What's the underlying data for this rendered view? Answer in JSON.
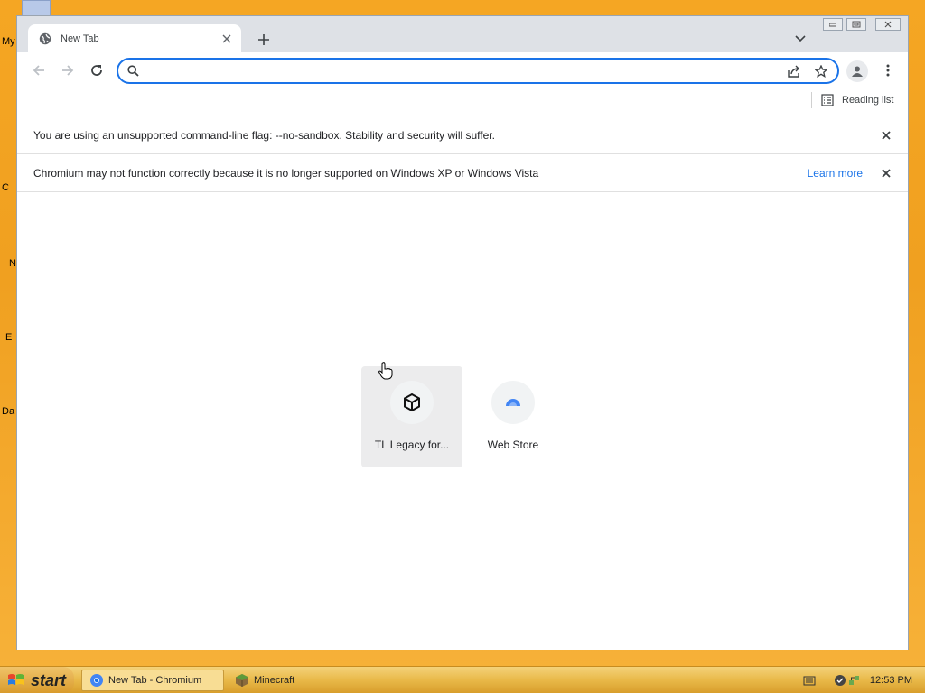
{
  "desktop": {
    "fragments": [
      "My",
      "C",
      "N",
      "E",
      "Da"
    ]
  },
  "browser": {
    "tab": {
      "title": "New Tab"
    },
    "omnibox": {
      "value": "",
      "placeholder": ""
    },
    "reading_list_label": "Reading list",
    "infobars": [
      {
        "text": "You are using an unsupported command-line flag: --no-sandbox. Stability and security will suffer.",
        "link": ""
      },
      {
        "text": "Chromium may not function correctly because it is no longer supported on Windows XP or Windows Vista",
        "link": "Learn more"
      }
    ],
    "shortcuts": [
      {
        "label": "TL Legacy for...",
        "icon": "cube-icon"
      },
      {
        "label": "Web Store",
        "icon": "web-store-icon"
      }
    ],
    "accent_color": "#1a73e8"
  },
  "taskbar": {
    "start_label": "start",
    "items": [
      {
        "label": "New Tab - Chromium",
        "active": true
      },
      {
        "label": "Minecraft",
        "active": false
      }
    ],
    "clock": "12:53 PM"
  }
}
